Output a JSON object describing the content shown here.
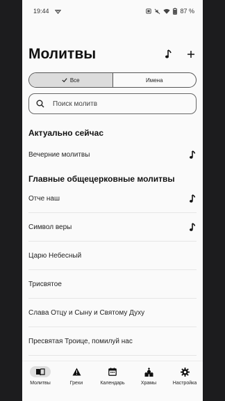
{
  "status_bar": {
    "time": "19:44",
    "battery": "87 %"
  },
  "header": {
    "title": "Молитвы"
  },
  "filter": {
    "all_label": "Все",
    "names_label": "Имена",
    "selected": "Все"
  },
  "search": {
    "placeholder": "Поиск молитв"
  },
  "sections": [
    {
      "title": "Актуально сейчас",
      "items": [
        {
          "label": "Вечерние молитвы",
          "audio": true
        }
      ]
    },
    {
      "title": "Главные общецерковные молитвы",
      "items": [
        {
          "label": "Отче наш",
          "audio": true
        },
        {
          "label": "Символ веры",
          "audio": true
        },
        {
          "label": "Царю Небесный",
          "audio": false
        },
        {
          "label": "Трисвятое",
          "audio": false
        },
        {
          "label": "Слава Отцу и Сыну и Святому Духу",
          "audio": false
        },
        {
          "label": "Пресвятая Троице, помилуй нас",
          "audio": false
        }
      ]
    }
  ],
  "bottom_nav": [
    {
      "label": "Молитвы",
      "icon": "book-icon",
      "active": true
    },
    {
      "label": "Грехи",
      "icon": "warning-icon",
      "active": false
    },
    {
      "label": "Календарь",
      "icon": "calendar-icon",
      "active": false
    },
    {
      "label": "Храмы",
      "icon": "church-icon",
      "active": false
    },
    {
      "label": "Настройка",
      "icon": "gear-icon",
      "active": false
    }
  ],
  "colors": {
    "background": "#fafafa",
    "text": "#111111",
    "active_segment": "#dcdcdc",
    "outer": "#1c1c1e"
  }
}
